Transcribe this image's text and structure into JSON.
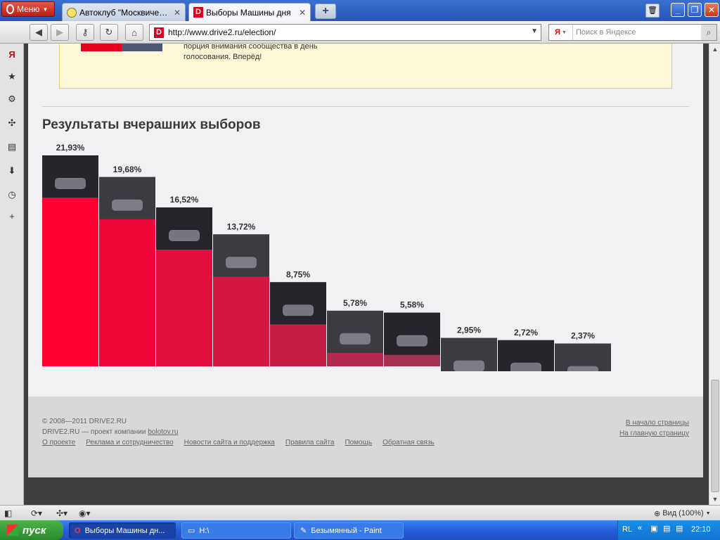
{
  "browser": {
    "menu_label": "Меню",
    "tabs": [
      {
        "title": "Автоклуб \"Москвичема...",
        "icon": "club-favicon"
      },
      {
        "title": "Выборы Машины дня",
        "icon": "drive2-favicon"
      }
    ],
    "address": "http://www.drive2.ru/election/",
    "search_placeholder": "Поиск в Яндексе",
    "search_engine": "Я",
    "favicon_letter": "D",
    "zoom": "Вид (100%)"
  },
  "notice": {
    "text": "порция внимания сообщества в день голосования. Вперёд!"
  },
  "results": {
    "title": "Результаты вчерашних выборов"
  },
  "chart_data": {
    "type": "bar",
    "categories": [
      "21,93%",
      "19,68%",
      "16,52%",
      "13,72%",
      "8,75%",
      "5,78%",
      "5,58%",
      "2,95%",
      "2,72%",
      "2,37%"
    ],
    "values": [
      21.93,
      19.68,
      16.52,
      13.72,
      8.75,
      5.78,
      5.58,
      2.95,
      2.72,
      2.37
    ],
    "colors": [
      "#ff0030",
      "#f2073a",
      "#e40f3e",
      "#d41743",
      "#c51f47",
      "#b4294d",
      "#a53153",
      "#86435e",
      "#785065",
      "#636b86"
    ],
    "title": "Результаты вчерашних выборов",
    "xlabel": "",
    "ylabel": "",
    "ylim": [
      0,
      24
    ]
  },
  "footer": {
    "copyright": "© 2008—2011 DRIVE2.RU",
    "project_prefix": "DRIVE2.RU — проект компании ",
    "company": "bolotov.ru",
    "links": [
      "О проекте",
      "Реклама и сотрудничество",
      "Новости сайта и поддержка",
      "Правила сайта",
      "Помощь",
      "Обратная связь"
    ],
    "to_top": "В начало страницы",
    "to_home": "На главную страницу"
  },
  "taskbar": {
    "start": "пуск",
    "tasks": [
      "Выборы Машины дн...",
      "H:\\",
      "Безымянный - Paint"
    ],
    "lang": "RL",
    "clock": "22:10"
  }
}
